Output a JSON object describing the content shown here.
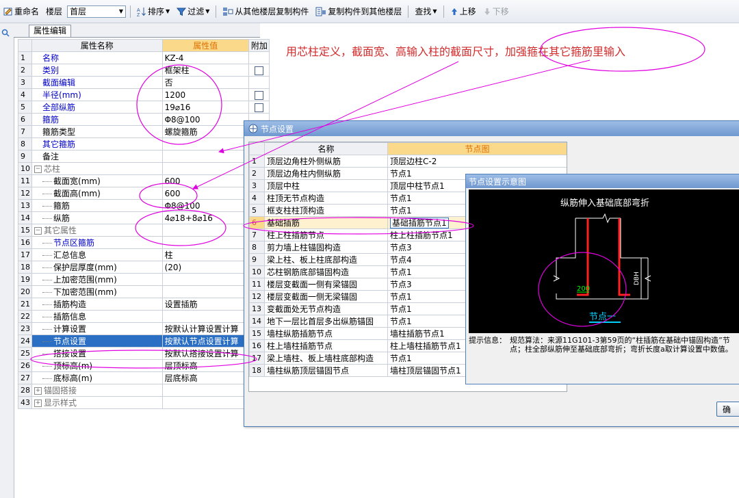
{
  "toolbar": {
    "rename": "重命名",
    "floor_label": "楼层",
    "floor_value": "首层",
    "sort": "排序",
    "filter": "过滤",
    "copy_from_other": "从其他楼层复制构件",
    "copy_to_other": "复制构件到其他楼层",
    "find": "查找",
    "move_up": "上移",
    "move_down": "下移"
  },
  "left_tab": "属性编辑",
  "prop_table": {
    "headers": [
      "属性名称",
      "属性值",
      "附加"
    ],
    "rows": [
      {
        "num": "1",
        "name": "名称",
        "value": "KZ-4"
      },
      {
        "num": "2",
        "name": "类别",
        "value": "框架柱"
      },
      {
        "num": "3",
        "name": "截面编辑",
        "value": "否"
      },
      {
        "num": "4",
        "name": "半径(mm)",
        "value": "1200"
      },
      {
        "num": "5",
        "name": "全部纵筋",
        "value": "19⌀16"
      },
      {
        "num": "6",
        "name": "箍筋",
        "value": "Φ8@100"
      },
      {
        "num": "7",
        "name": "箍筋类型",
        "value": "螺旋箍筋"
      },
      {
        "num": "8",
        "name": "其它箍筋",
        "value": ""
      },
      {
        "num": "9",
        "name": "备注",
        "value": ""
      },
      {
        "num": "10",
        "name": "芯柱",
        "value": ""
      },
      {
        "num": "11",
        "name": "截面宽(mm)",
        "value": "600"
      },
      {
        "num": "12",
        "name": "截面高(mm)",
        "value": "600"
      },
      {
        "num": "13",
        "name": "箍筋",
        "value": "Φ8@100"
      },
      {
        "num": "14",
        "name": "纵筋",
        "value": "4⌀18+8⌀16"
      },
      {
        "num": "15",
        "name": "其它属性",
        "value": ""
      },
      {
        "num": "16",
        "name": "节点区箍筋",
        "value": ""
      },
      {
        "num": "17",
        "name": "汇总信息",
        "value": "柱"
      },
      {
        "num": "18",
        "name": "保护层厚度(mm)",
        "value": "(20)"
      },
      {
        "num": "19",
        "name": "上加密范围(mm)",
        "value": ""
      },
      {
        "num": "20",
        "name": "下加密范围(mm)",
        "value": ""
      },
      {
        "num": "21",
        "name": "插筋构造",
        "value": "设置插筋"
      },
      {
        "num": "22",
        "name": "插筋信息",
        "value": ""
      },
      {
        "num": "23",
        "name": "计算设置",
        "value": "按默认计算设置计算"
      },
      {
        "num": "24",
        "name": "节点设置",
        "value": "按默认节点设置计算"
      },
      {
        "num": "25",
        "name": "搭接设置",
        "value": "按默认搭接设置计算"
      },
      {
        "num": "26",
        "name": "顶标高(m)",
        "value": "层顶标高"
      },
      {
        "num": "27",
        "name": "底标高(m)",
        "value": "层底标高"
      },
      {
        "num": "28",
        "name": "锚固搭接",
        "value": ""
      },
      {
        "num": "43",
        "name": "显示样式",
        "value": ""
      }
    ]
  },
  "annotation": "用芯柱定义，截面宽、高输入柱的截面尺寸，加强箍在其它箍筋里输入",
  "node_dialog": {
    "title": "节点设置",
    "headers": [
      "名称",
      "节点图"
    ],
    "rows": [
      {
        "num": "1",
        "name": "顶层边角柱外侧纵筋",
        "value": "顶层边柱C-2"
      },
      {
        "num": "2",
        "name": "顶层边角柱内侧纵筋",
        "value": "节点1"
      },
      {
        "num": "3",
        "name": "顶层中柱",
        "value": "顶层中柱节点1"
      },
      {
        "num": "4",
        "name": "柱顶无节点构造",
        "value": "节点1"
      },
      {
        "num": "5",
        "name": "框支柱柱顶构造",
        "value": "节点1"
      },
      {
        "num": "6",
        "name": "基础插筋",
        "value": "基础插筋节点1"
      },
      {
        "num": "7",
        "name": "柱上柱插筋节点",
        "value": "柱上柱插筋节点1"
      },
      {
        "num": "8",
        "name": "剪力墙上柱锚固构造",
        "value": "节点3"
      },
      {
        "num": "9",
        "name": "梁上柱、板上柱底部构造",
        "value": "节点4"
      },
      {
        "num": "10",
        "name": "芯柱钢筋底部锚固构造",
        "value": "节点1"
      },
      {
        "num": "11",
        "name": "楼层变截面一侧有梁锚固",
        "value": "节点3"
      },
      {
        "num": "12",
        "name": "楼层变截面一侧无梁锚固",
        "value": "节点1"
      },
      {
        "num": "13",
        "name": "变截面处无节点构造",
        "value": "节点1"
      },
      {
        "num": "14",
        "name": "地下一层比首层多出纵筋锚固",
        "value": "节点1"
      },
      {
        "num": "15",
        "name": "墙柱纵筋插筋节点",
        "value": "墙柱插筋节点1"
      },
      {
        "num": "16",
        "name": "柱上墙柱插筋节点",
        "value": "柱上墙柱插筋节点1"
      },
      {
        "num": "17",
        "name": "梁上墙柱、板上墙柱底部构造",
        "value": "节点1"
      },
      {
        "num": "18",
        "name": "墙柱纵筋顶层锚固节点",
        "value": "墙柱顶层锚固节点1"
      }
    ],
    "ok_label": "确"
  },
  "schematic": {
    "title": "节点设置示意图",
    "caption": "纵筋伸入基础底部弯折",
    "dim_200": "200",
    "dim_dbh": "DBH",
    "node_label": "节点一",
    "info_label": "提示信息：",
    "info_text": "规范算法：来源11G101-3第59页的“柱插筋在基础中锚固构造”节点；柱全部纵筋伸至基础底部弯折；弯折长度a取计算设置中数值。"
  },
  "colors": {
    "annotation": "#d22b2b",
    "highlight_header": "#fbd98a",
    "selection": "#2b6fc4",
    "ellipse": "#e000e0",
    "rebar": "#ff2020",
    "node_label": "#00d0ff"
  }
}
